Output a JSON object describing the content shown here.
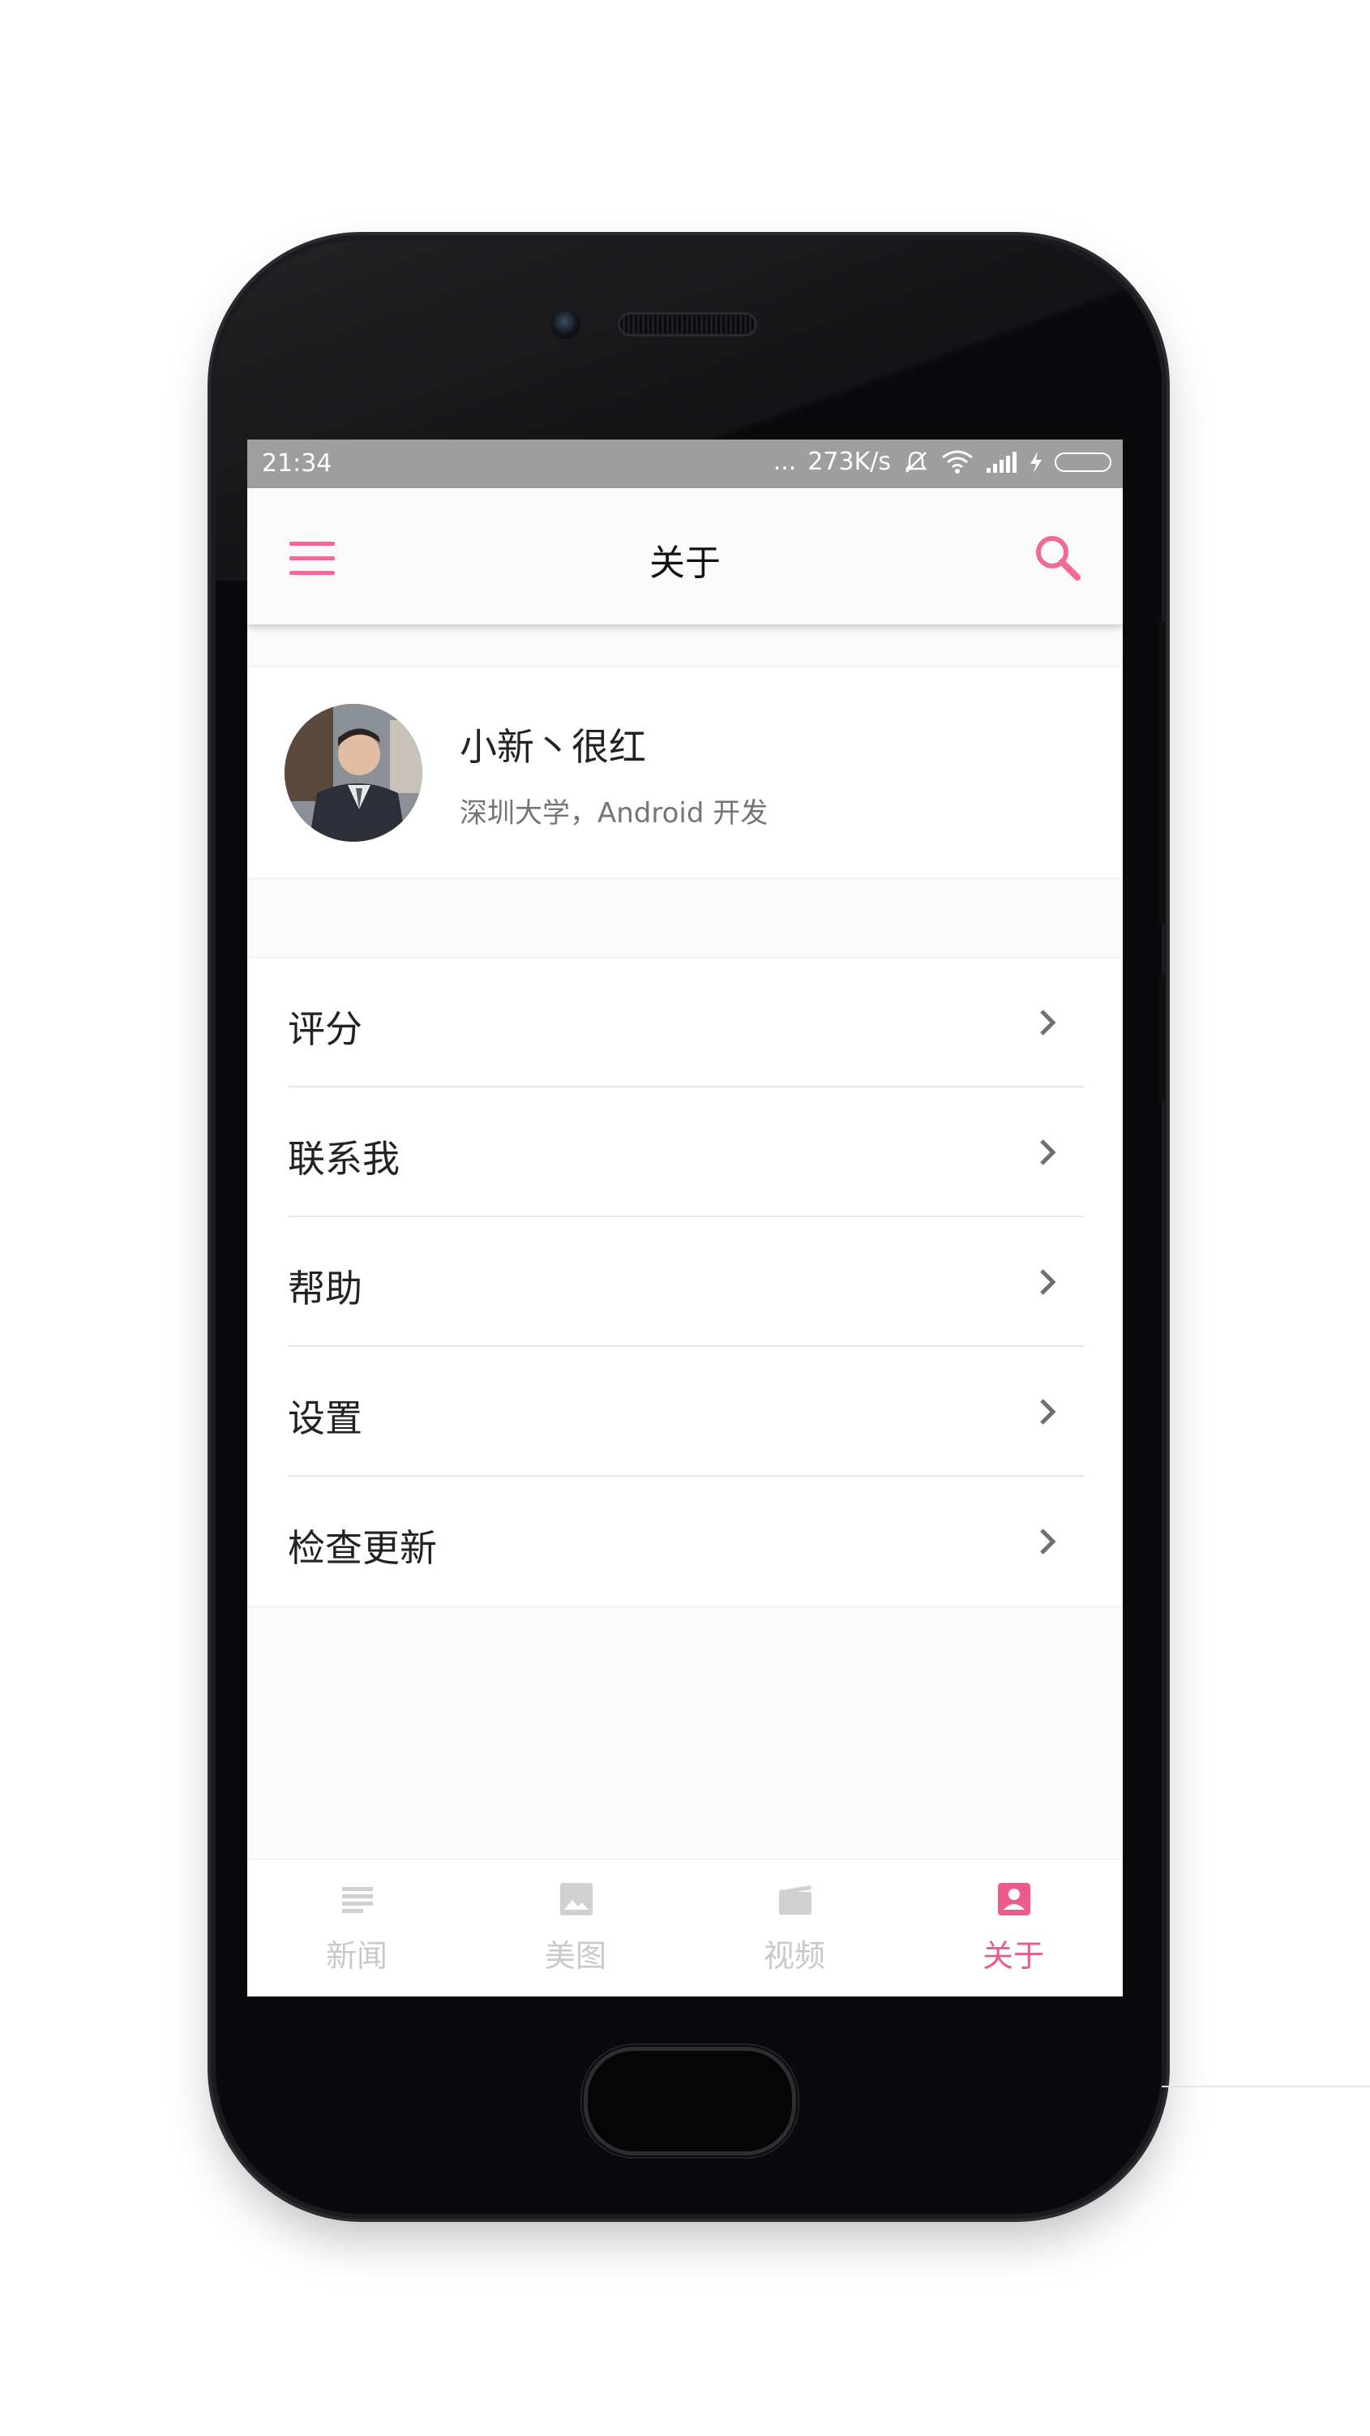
{
  "status_bar": {
    "time": "21:34",
    "dots": "...",
    "speed": "273K/s"
  },
  "toolbar": {
    "title": "关于",
    "accent_color": "#ef6b95"
  },
  "profile": {
    "name": "小新丶很红",
    "description": "深圳大学，Android 开发"
  },
  "menu": [
    {
      "label": "评分"
    },
    {
      "label": "联系我"
    },
    {
      "label": "帮助"
    },
    {
      "label": "设置"
    },
    {
      "label": "检查更新"
    }
  ],
  "bottom_nav": [
    {
      "label": "新闻",
      "icon": "news-icon",
      "active": false
    },
    {
      "label": "美图",
      "icon": "image-icon",
      "active": false
    },
    {
      "label": "视频",
      "icon": "video-icon",
      "active": false
    },
    {
      "label": "关于",
      "icon": "profile-icon",
      "active": true
    }
  ]
}
